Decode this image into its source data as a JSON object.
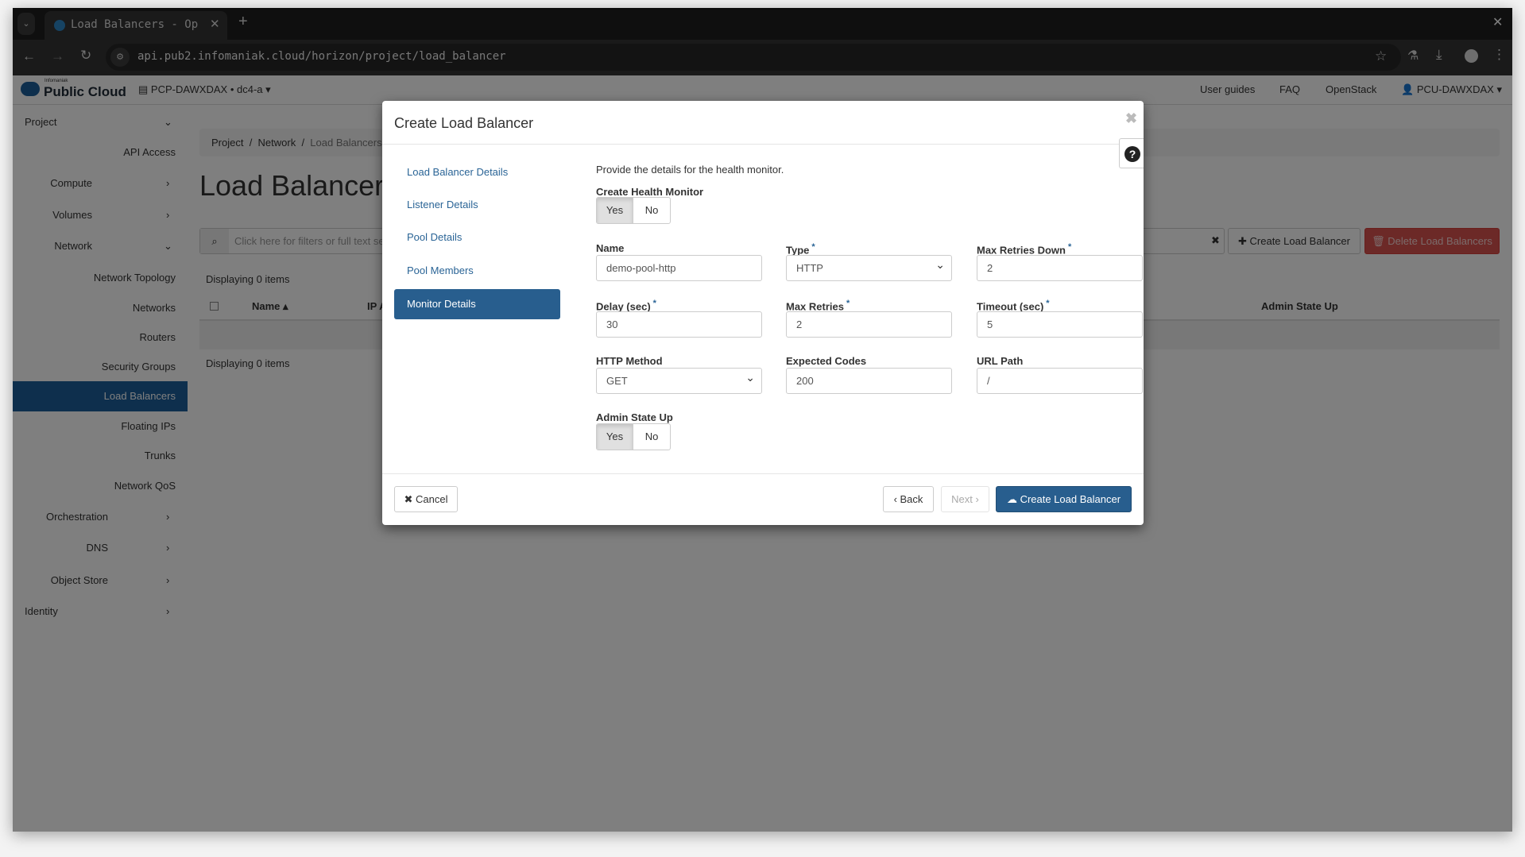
{
  "browser": {
    "tab_title": "Load Balancers - Open",
    "url": "api.pub2.infomaniak.cloud/horizon/project/load_balancer"
  },
  "header": {
    "brand_small": "Infomaniak",
    "brand": "Public Cloud",
    "project": "PCP-DAWXDAX • dc4-a",
    "links": [
      "User guides",
      "FAQ",
      "OpenStack"
    ],
    "user": "PCU-DAWXDAX"
  },
  "sidebar": {
    "project": "Project",
    "api_access": "API Access",
    "compute": "Compute",
    "volumes": "Volumes",
    "network": "Network",
    "network_items": [
      "Network Topology",
      "Networks",
      "Routers",
      "Security Groups",
      "Load Balancers",
      "Floating IPs",
      "Trunks",
      "Network QoS"
    ],
    "active": "Load Balancers",
    "orchestration": "Orchestration",
    "dns": "DNS",
    "object_store": "Object Store",
    "identity": "Identity"
  },
  "main": {
    "breadcrumb": [
      "Project",
      "Network",
      "Load Balancers"
    ],
    "title": "Load Balancers",
    "filter_placeholder": "Click here for filters or full text search.",
    "create_btn": "Create Load Balancer",
    "delete_btn": "Delete Load Balancers",
    "displaying": "Displaying 0 items",
    "columns": [
      "Name",
      "IP Address",
      "Admin State Up"
    ]
  },
  "modal": {
    "title": "Create Load Balancer",
    "steps": [
      "Load Balancer Details",
      "Listener Details",
      "Pool Details",
      "Pool Members",
      "Monitor Details"
    ],
    "active_step": "Monitor Details",
    "intro": "Provide the details for the health monitor.",
    "create_health_monitor": {
      "label": "Create Health Monitor",
      "yes": "Yes",
      "no": "No",
      "selected": "Yes"
    },
    "fields": {
      "name": {
        "label": "Name",
        "value": "demo-pool-http"
      },
      "type": {
        "label": "Type",
        "value": "HTTP"
      },
      "max_retries_down": {
        "label": "Max Retries Down",
        "value": "2"
      },
      "delay": {
        "label": "Delay (sec)",
        "value": "30"
      },
      "max_retries": {
        "label": "Max Retries",
        "value": "2"
      },
      "timeout": {
        "label": "Timeout (sec)",
        "value": "5"
      },
      "http_method": {
        "label": "HTTP Method",
        "value": "GET"
      },
      "expected_codes": {
        "label": "Expected Codes",
        "value": "200"
      },
      "url_path": {
        "label": "URL Path",
        "value": "/"
      }
    },
    "admin_state": {
      "label": "Admin State Up",
      "yes": "Yes",
      "no": "No",
      "selected": "Yes"
    },
    "cancel": "Cancel",
    "back": "Back",
    "next": "Next",
    "create": "Create Load Balancer"
  },
  "colors": {
    "primary": "#285e8e",
    "danger": "#d9534f",
    "link": "#2a6496"
  }
}
